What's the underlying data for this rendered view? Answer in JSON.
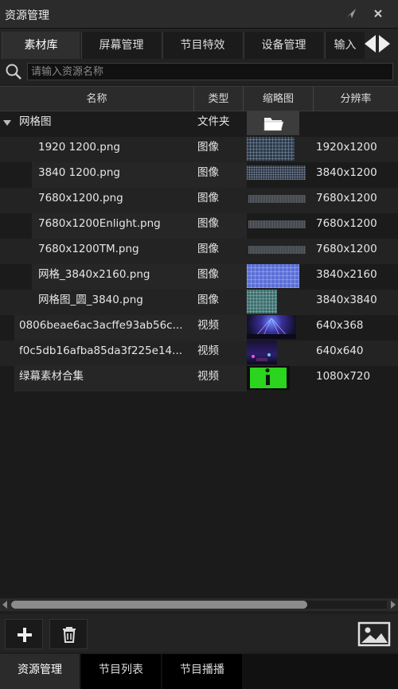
{
  "window": {
    "title": "资源管理"
  },
  "tabs": [
    {
      "label": "素材库",
      "active": true
    },
    {
      "label": "屏幕管理",
      "active": false
    },
    {
      "label": "节目特效",
      "active": false
    },
    {
      "label": "设备管理",
      "active": false
    },
    {
      "label": "输入",
      "active": false
    }
  ],
  "search": {
    "placeholder": "请输入资源名称",
    "value": ""
  },
  "columns": [
    "名称",
    "类型",
    "缩略图",
    "分辨率"
  ],
  "rows": [
    {
      "name": "网格图",
      "type": "文件夹",
      "resolution": "",
      "thumb": "folder-icon",
      "level": 0,
      "expanded": true
    },
    {
      "name": "1920    1200.png",
      "type": "图像",
      "resolution": "1920x1200",
      "thumb": "grid-dense",
      "level": 1
    },
    {
      "name": "3840  1200.png",
      "type": "图像",
      "resolution": "3840x1200",
      "thumb": "grid-wide",
      "level": 1
    },
    {
      "name": "7680x1200.png",
      "type": "图像",
      "resolution": "7680x1200",
      "thumb": "strip",
      "level": 1
    },
    {
      "name": "7680x1200Enlight.png",
      "type": "图像",
      "resolution": "7680x1200",
      "thumb": "strip",
      "level": 1
    },
    {
      "name": "7680x1200TM.png",
      "type": "图像",
      "resolution": "7680x1200",
      "thumb": "strip",
      "level": 1
    },
    {
      "name": "网格_3840x2160.png",
      "type": "图像",
      "resolution": "3840x2160",
      "thumb": "blue-grid",
      "level": 1
    },
    {
      "name": "网格图_圆_3840.png",
      "type": "图像",
      "resolution": "3840x3840",
      "thumb": "teal-square",
      "level": 1
    },
    {
      "name": "0806beae6ac3acffe93ab56c...",
      "type": "视频",
      "resolution": "640x368",
      "thumb": "concert",
      "level": 0
    },
    {
      "name": "f0c5db16afba85da3f225e14...",
      "type": "视频",
      "resolution": "640x640",
      "thumb": "stage",
      "level": 0
    },
    {
      "name": "绿幕素材合集",
      "type": "视频",
      "resolution": "1080x720",
      "thumb": "greenscreen",
      "level": 0
    }
  ],
  "bottom_tabs": [
    {
      "label": "资源管理",
      "active": true
    },
    {
      "label": "节目列表",
      "active": false
    },
    {
      "label": "节目播播",
      "active": false
    }
  ],
  "colors": {
    "accent_green": "#2bd41e",
    "blue_grid": "#5b6fd6",
    "background": "#1e1e1e"
  }
}
